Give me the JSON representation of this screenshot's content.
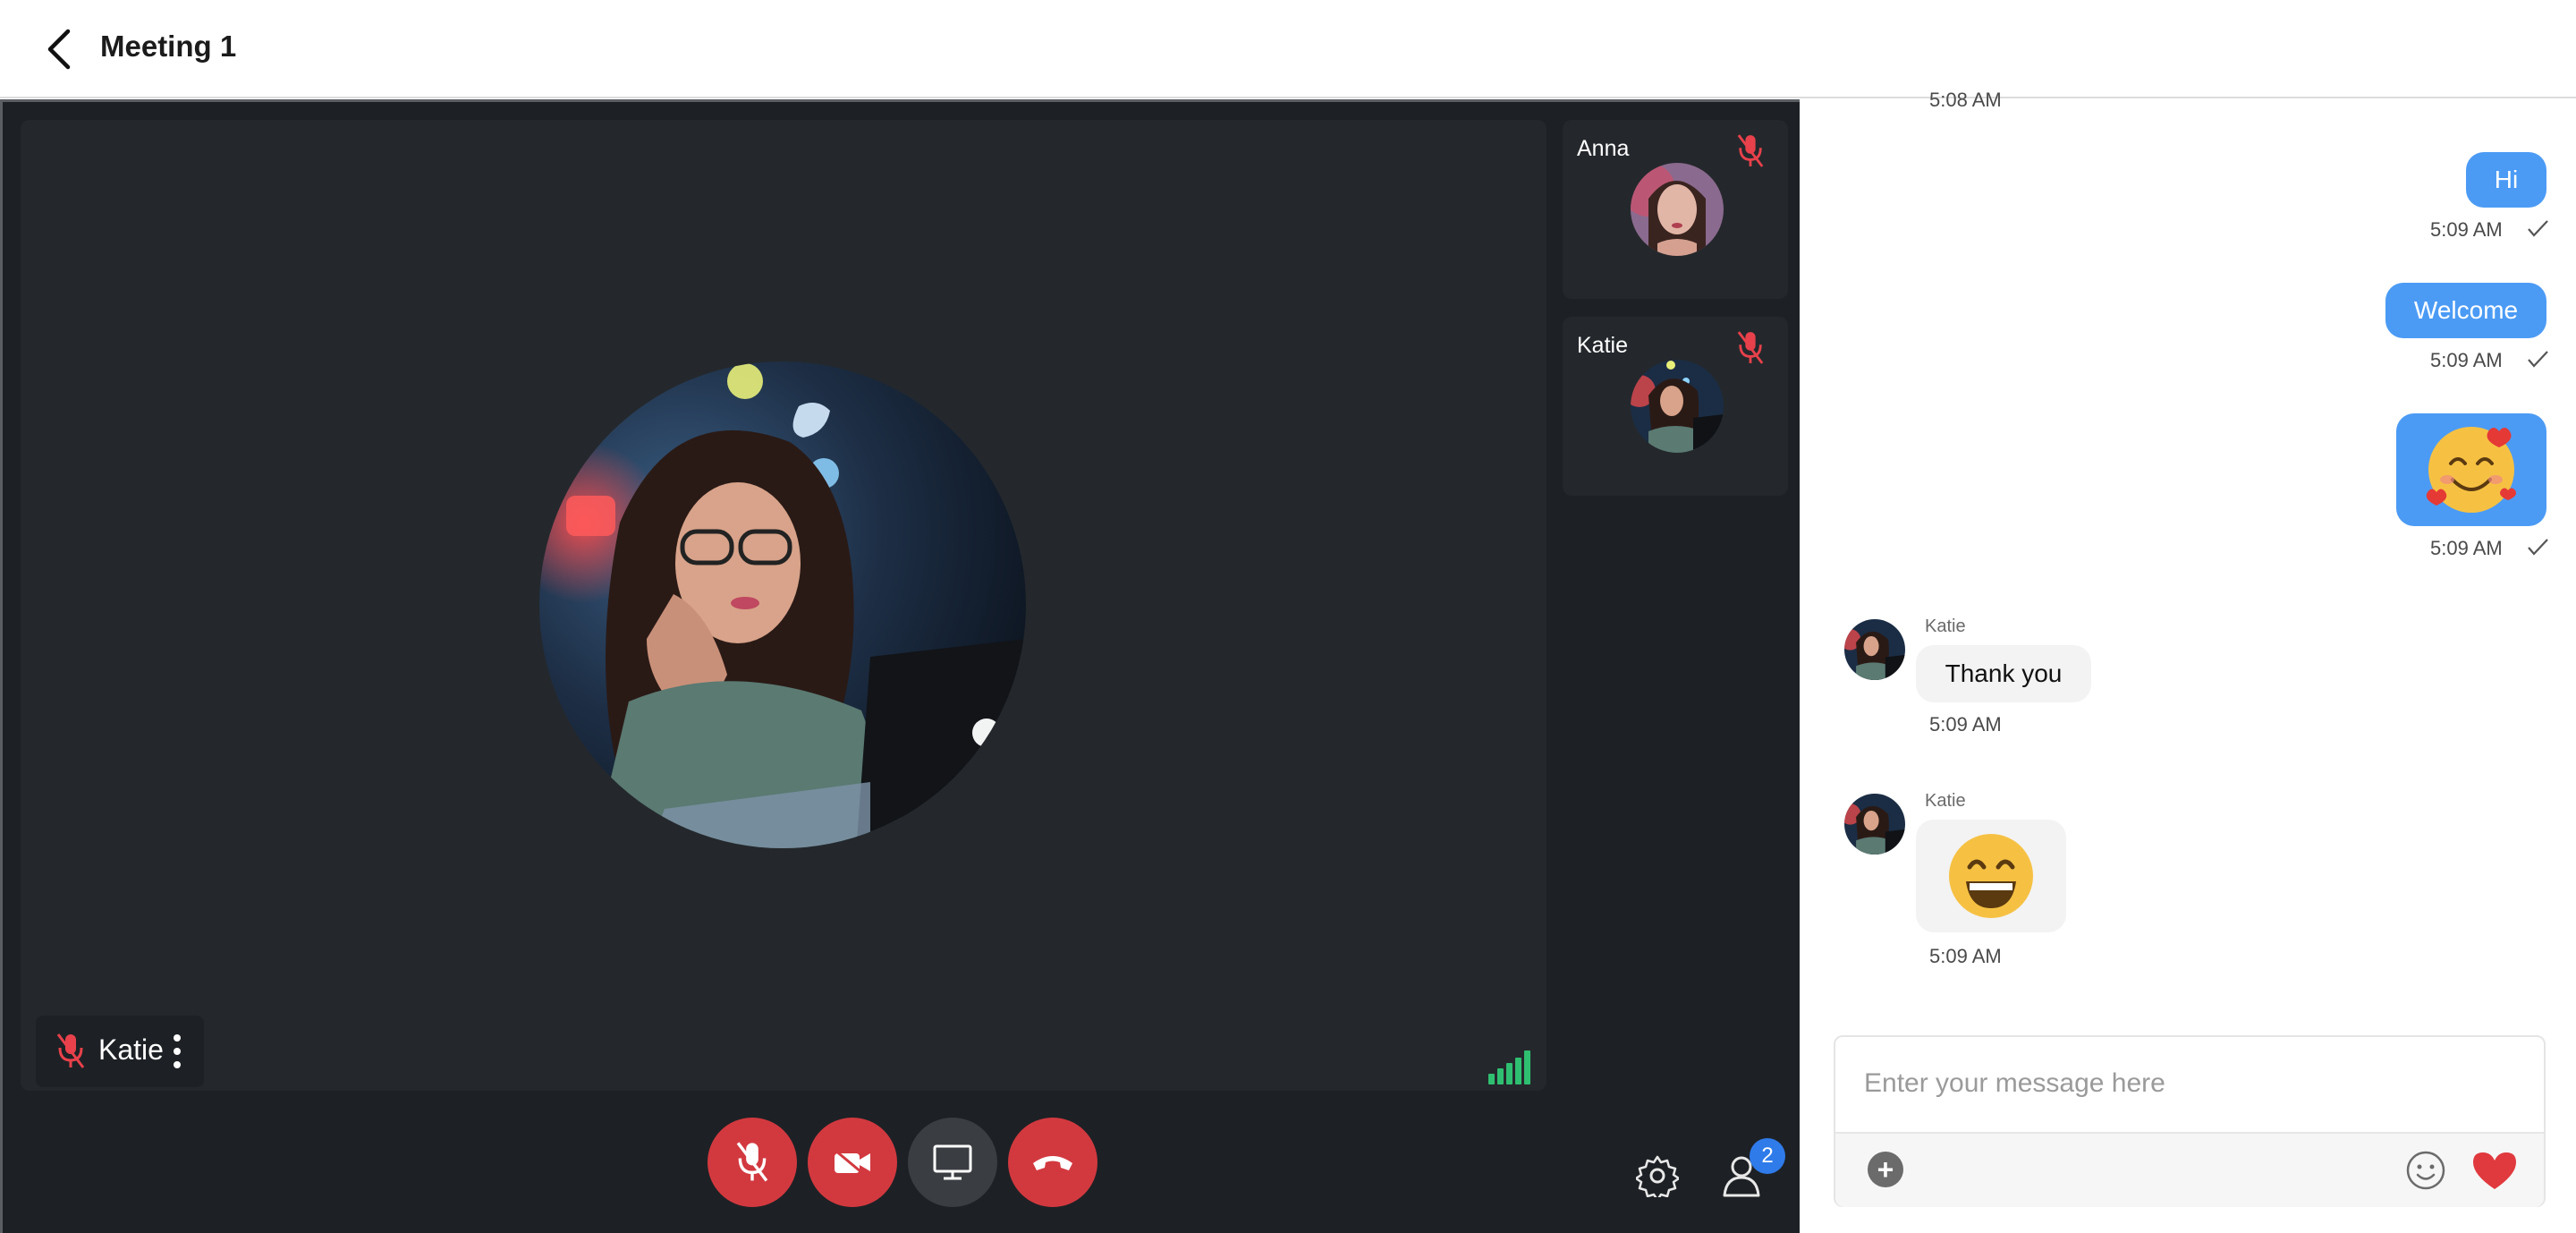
{
  "header": {
    "title": "Meeting 1"
  },
  "main_tile": {
    "name": "Katie"
  },
  "side_tiles": [
    {
      "name": "Anna"
    },
    {
      "name": "Katie"
    }
  ],
  "participants_badge": "2",
  "chat": {
    "top_partial_time": "5:08 AM",
    "sent": [
      {
        "text": "Hi",
        "time": "5:09 AM"
      },
      {
        "text": "Welcome",
        "time": "5:09 AM"
      },
      {
        "text": "",
        "emoji": "smiling-face-with-hearts",
        "time": "5:09 AM"
      }
    ],
    "received": [
      {
        "sender": "Katie",
        "text": "Thank you",
        "time": "5:09 AM"
      },
      {
        "sender": "Katie",
        "text": "",
        "emoji": "grinning-face",
        "time": "5:09 AM"
      }
    ],
    "composer": {
      "placeholder": "Enter your message here"
    }
  },
  "colors": {
    "accent_blue": "#4b9bf5",
    "control_red": "#d2393f",
    "signal_green": "#2fbf71",
    "badge_blue": "#2f7bea"
  }
}
